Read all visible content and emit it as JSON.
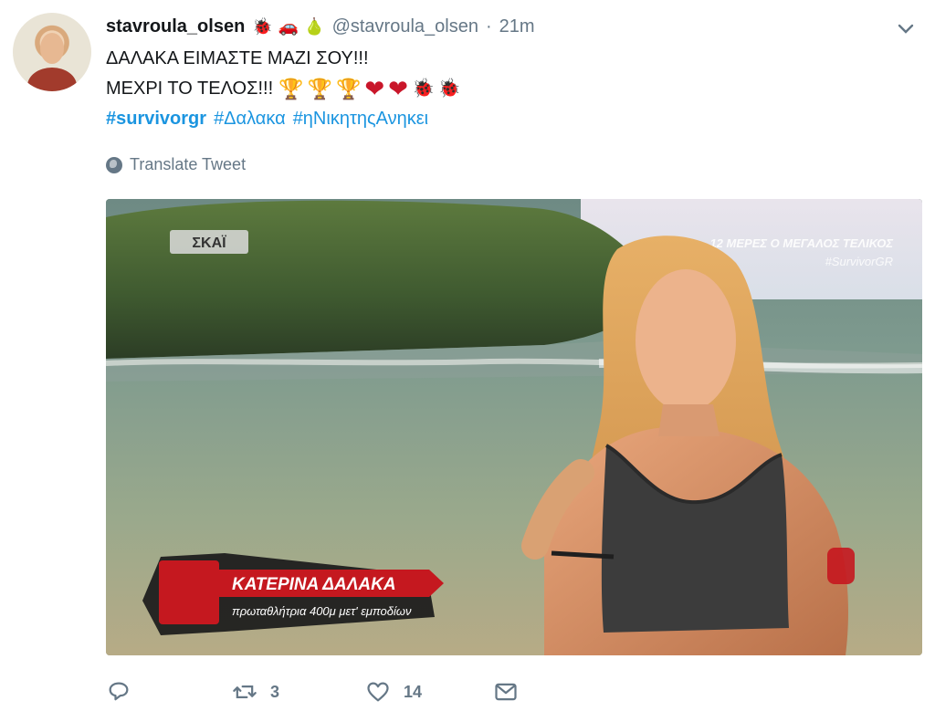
{
  "tweet": {
    "display_name": "stavroula_olsen",
    "handle": "@stavroula_olsen",
    "separator": "·",
    "timestamp": "21m",
    "header_badges": [
      "🐞",
      "🚗",
      "🍐"
    ],
    "line1": "ΔΑΛΑΚΑ ΕΙΜΑΣΤΕ ΜΑΖΙ ΣΟΥ!!!",
    "line2": "ΜΕΧΡΙ ΤΟ ΤΕΛΟΣ!!!",
    "line2_emojis": [
      "🏆",
      "🏆",
      "🏆",
      "❤",
      "❤",
      "🐞",
      "🐞"
    ],
    "hashtags": [
      "#survivorgr",
      "#Δαλακα",
      "#ηΝικητηςΑνηκει"
    ],
    "translate_label": "Translate Tweet"
  },
  "media": {
    "channel_logo": "ΣΚΑΪ",
    "overlay_top_line1": "12 ΜΕΡΕΣ Ο ΜΕΓΑΛΟΣ ΤΕΛΙΚΟΣ",
    "overlay_top_line2": "#SurvivorGR",
    "lower_third_name": "ΚΑΤΕΡΙΝΑ ΔΑΛΑΚΑ",
    "lower_third_subtitle": "πρωταθλήτρια 400μ μετ' εμποδίων"
  },
  "actions": {
    "reply_count": "",
    "retweet_count": "3",
    "like_count": "14"
  },
  "icons": {
    "chevron": "chevron-down-icon",
    "translate": "globe-icon",
    "reply": "reply-icon",
    "retweet": "retweet-icon",
    "like": "heart-icon",
    "dm": "envelope-icon"
  },
  "colors": {
    "link": "#1b95e0",
    "muted": "#657786",
    "text": "#14171a"
  }
}
